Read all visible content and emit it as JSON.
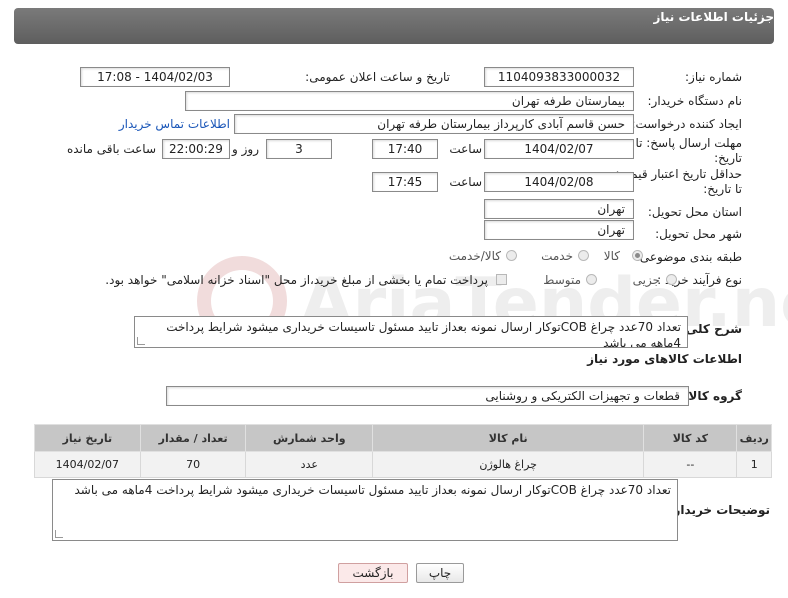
{
  "header": {
    "title": "جزئیات اطلاعات نیاز"
  },
  "fields": {
    "need_number_label": "شماره نیاز:",
    "need_number": "1104093833000032",
    "announce_label": "تاریخ و ساعت اعلان عمومی:",
    "announce_value": "1404/02/03 - 17:08",
    "buyer_org_label": "نام دستگاه خریدار:",
    "buyer_org": "بیمارستان طرفه تهران",
    "creator_label": "ایجاد کننده درخواست:",
    "creator": "حسن قاسم آبادی کارپرداز بیمارستان طرفه تهران",
    "contact_link": "اطلاعات تماس خریدار",
    "deadline_label_1": "مهلت ارسال پاسخ: تا",
    "deadline_label_2": "تاریخ:",
    "deadline_date": "1404/02/07",
    "time_label": "ساعت",
    "deadline_time": "17:40",
    "days_value": "3",
    "days_label": "روز و",
    "remaining_value": "22:00:29",
    "remaining_label": "ساعت باقی مانده",
    "price_valid_label_1": "حداقل تاریخ اعتبار قیمت:",
    "price_valid_label_2": "تا تاریخ:",
    "price_valid_date": "1404/02/08",
    "price_valid_time": "17:45",
    "province_label": "استان محل تحویل:",
    "province": "تهران",
    "city_label": "شهر محل تحویل:",
    "city": "تهران",
    "category_label": "طبقه بندی موضوعی:",
    "category_options": [
      "کالا",
      "خدمت",
      "کالا/خدمت"
    ],
    "process_label": "نوع فرآیند خرید :",
    "process_options": [
      "جزیی",
      "متوسط"
    ],
    "treasury_note": "پرداخت تمام یا بخشی از مبلغ خرید،از محل \"اسناد خزانه اسلامی\" خواهد بود."
  },
  "description": {
    "label": "شرح کلی نیاز:",
    "text": "تعداد 70عدد چراغ COBتوکار ارسال نمونه بعداز تایید مسئول تاسیسات  خریداری میشود شرایط پرداخت 4ماهه می باشد"
  },
  "goods": {
    "section_title": "اطلاعات کالاهای مورد نیاز",
    "group_label": "گروه کالا:",
    "group_value": "قطعات و تجهیزات الکتریکی و روشنایی",
    "headers": [
      "ردیف",
      "کد کالا",
      "نام کالا",
      "واحد شمارش",
      "تعداد / مقدار",
      "تاریخ نیاز"
    ],
    "rows": [
      [
        "1",
        "--",
        "چراغ هالوژن",
        "عدد",
        "70",
        "1404/02/07"
      ]
    ]
  },
  "buyer_notes": {
    "label": "توضیحات خریدار:",
    "text": "تعداد 70عدد چراغ COBتوکار ارسال نمونه بعداز تایید مسئول تاسیسات  خریداری میشود شرایط پرداخت 4ماهه می باشد"
  },
  "buttons": {
    "print": "چاپ",
    "back": "بازگشت"
  },
  "watermark": {
    "text": "AriaTender.neT"
  },
  "colors": {
    "header_bg": "#6b6b6b",
    "table_header": "#c6c6c6",
    "link": "#1a56b8"
  }
}
